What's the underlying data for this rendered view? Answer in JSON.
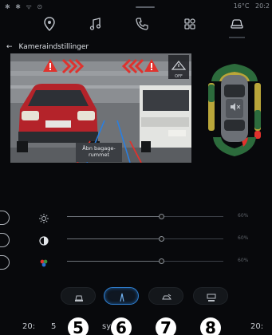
{
  "status": {
    "left_icons": "✱ ✱ ᯤ ⊙",
    "temperature": "16°C",
    "time": "20:2"
  },
  "nav": {
    "items": [
      {
        "name": "navigation",
        "icon": "map-pin-icon"
      },
      {
        "name": "music",
        "icon": "music-note-icon"
      },
      {
        "name": "phone",
        "icon": "phone-icon"
      },
      {
        "name": "apps",
        "icon": "apps-grid-icon"
      },
      {
        "name": "vehicle",
        "icon": "car-icon"
      }
    ]
  },
  "page": {
    "back_label": "←",
    "title": "Kameraindstillinger"
  },
  "camera": {
    "tooltip": "Åbn bagage-\nrummet",
    "off_badge": "OFF"
  },
  "sliders": [
    {
      "name": "brightness",
      "icon": "sun-icon",
      "value": 0.6,
      "label": "60%"
    },
    {
      "name": "contrast",
      "icon": "contrast-icon",
      "value": 0.6,
      "label": "60%"
    },
    {
      "name": "color",
      "icon": "color-palette-icon",
      "value": 0.6,
      "label": "60%"
    }
  ],
  "views": [
    {
      "name": "rear-view",
      "icon": "rear-camera-icon",
      "selected": false
    },
    {
      "name": "front-view",
      "icon": "front-camera-icon",
      "selected": true
    },
    {
      "name": "side-view",
      "icon": "side-camera-icon",
      "selected": false
    },
    {
      "name": "auto-view",
      "icon": "auto-camera-icon",
      "selected": false
    }
  ],
  "callouts": [
    "5",
    "6",
    "7",
    "8"
  ],
  "bottombar": {
    "left_temp": "20:",
    "left_fan": "5",
    "mid_label": "sy",
    "right_temp": "20:"
  },
  "colors": {
    "accent_blue": "#2f7fd0",
    "warning_red": "#e0322d",
    "sensor_green": "#2c6b3c",
    "sensor_yellow": "#b9a63a"
  }
}
